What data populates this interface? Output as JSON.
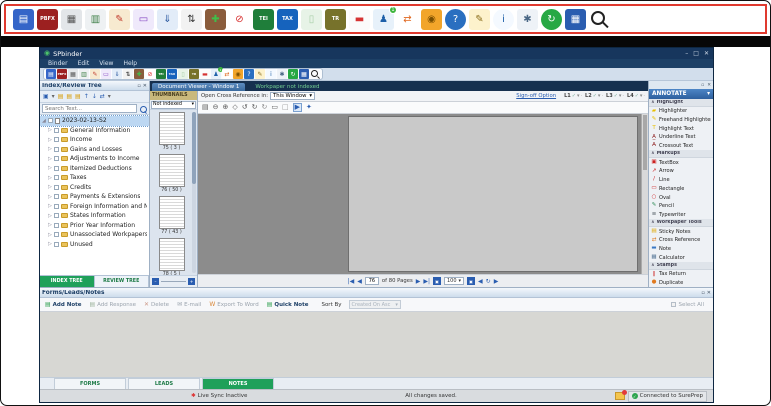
{
  "glyphs": {
    "check": "✓",
    "caret": "▾",
    "chevup": "∧",
    "close": "✕",
    "pin": "▫",
    "expander": "▷",
    "root_expander": "◢",
    "app": "◉",
    "sep": "·",
    "minimize": "–",
    "maximize": "□",
    "livesync": "✱"
  },
  "top_toolbar": {
    "icons": [
      {
        "name": "save-icon",
        "g": "▤",
        "fg": "#ffffff",
        "bg": "#3565c8"
      },
      {
        "name": "pbfx-export-icon",
        "g": "PBFX",
        "fg": "#ffffff",
        "bg": "#9c2020",
        "cls": "txt"
      },
      {
        "name": "print-icon",
        "g": "▦",
        "fg": "#555555",
        "bg": "#e3e6e9"
      },
      {
        "name": "print-preview-icon",
        "g": "▥",
        "fg": "#3a7d44",
        "bg": "#eef1f3"
      },
      {
        "name": "review-sheet-icon",
        "g": "✎",
        "fg": "#c0392b",
        "bg": "#f7ead0"
      },
      {
        "name": "send-to-screen-icon",
        "g": "▭",
        "fg": "#8040c0",
        "bg": "#efe9fb"
      },
      {
        "name": "network-transfer-icon",
        "g": "⇓",
        "fg": "#2c5aa0",
        "bg": "#e2ecf8"
      },
      {
        "name": "reorder-pages-icon",
        "g": "⇅",
        "fg": "#333333",
        "bg": "#f2f2f2"
      },
      {
        "name": "add-stamp-icon",
        "g": "✚",
        "fg": "#3fc04a",
        "bg": "#8a5c3c"
      },
      {
        "name": "restricted-icon",
        "g": "⊘",
        "fg": "#d62828",
        "bg": "#ffffff"
      },
      {
        "name": "tei-icon",
        "g": "TEI",
        "fg": "#ffffff",
        "bg": "#1f7e3a",
        "cls": "txt"
      },
      {
        "name": "tax-icon",
        "g": "TAX",
        "fg": "#ffffff",
        "bg": "#1663bd",
        "cls": "txt"
      },
      {
        "name": "binder-faded-icon",
        "g": "▯",
        "fg": "#a8cfa8",
        "bg": "#e7f3e7"
      },
      {
        "name": "tr-icon",
        "g": "TR",
        "fg": "#ffffff",
        "bg": "#77722b",
        "cls": "txt"
      },
      {
        "name": "sticky-note-icon",
        "g": "▬",
        "fg": "#d63333",
        "bg": "#fbfbfb"
      },
      {
        "name": "user-notifications-icon",
        "g": "♟",
        "fg": "#1d5fa8",
        "bg": "#e7f1fa",
        "badge": "1"
      },
      {
        "name": "transfer-arrows-icon",
        "g": "⇄",
        "fg": "#e06820",
        "bg": "#ffffff"
      },
      {
        "name": "lock-icon",
        "g": "◉",
        "fg": "#7a4f01",
        "bg": "#f2a52a"
      },
      {
        "name": "help-icon",
        "g": "?",
        "fg": "#ffffff",
        "bg": "#2a6fc0",
        "cls": "round"
      },
      {
        "name": "signer-icon",
        "g": "✎",
        "fg": "#8a6d1a",
        "bg": "#fdf2cc"
      },
      {
        "name": "info-icon",
        "g": "i",
        "fg": "#1d5fa8",
        "bg": "#f4f9ff",
        "cls": "round"
      },
      {
        "name": "user-settings-icon",
        "g": "✱",
        "fg": "#4a6785",
        "bg": "#eef2f7"
      },
      {
        "name": "sync-icon",
        "g": "↻",
        "fg": "#ffffff",
        "bg": "#27a844",
        "cls": "round"
      },
      {
        "name": "workspace-grid-icon",
        "g": "▦",
        "fg": "#ffffff",
        "bg": "#2a5db0"
      },
      {
        "name": "search-icon",
        "g": "",
        "fg": "#222222",
        "bg": "transparent",
        "cls": "searchy"
      }
    ]
  },
  "window": {
    "title": "SPbinder",
    "menus": [
      "Binder",
      "Edit",
      "View",
      "Help"
    ],
    "controls": [
      {
        "name": "minimize-button",
        "g": "–"
      },
      {
        "name": "maximize-button",
        "g": "□"
      },
      {
        "name": "close-button",
        "g": "✕"
      }
    ]
  },
  "tree_panel": {
    "header": "Index/Review Tree",
    "search_placeholder": "Search Text...",
    "toolbar": [
      {
        "name": "new-folder-icon",
        "g": "▣",
        "c": "#2a5db0"
      },
      {
        "name": "folder-menu-icon",
        "g": "▾",
        "c": "#666666"
      },
      {
        "name": "expand-all-icon",
        "g": "▤",
        "c": "#d79b00"
      },
      {
        "name": "collapse-all-icon",
        "g": "▤",
        "c": "#d79b00"
      },
      {
        "name": "folder-icon",
        "g": "▤",
        "c": "#d79b00"
      },
      {
        "name": "move-up-icon",
        "g": "↑",
        "c": "#2a5db0"
      },
      {
        "name": "move-down-icon",
        "g": "↓",
        "c": "#2a5db0"
      },
      {
        "name": "link-icon",
        "g": "⇄",
        "c": "#2a5db0"
      },
      {
        "name": "more-icon",
        "g": "▾",
        "c": "#666666"
      }
    ],
    "root": "2023-02-13-S2",
    "items": [
      "General Information",
      "Income",
      "Gains and Losses",
      "Adjustments to Income",
      "Itemized Deductions",
      "Taxes",
      "Credits",
      "Payments & Extensions",
      "Foreign Information and Nonresident",
      "States Information",
      "Prior Year Information",
      "Unassociated Workpapers",
      "Unused"
    ],
    "tabs": [
      {
        "label": "INDEX TREE",
        "cls": "active",
        "name": "tab-index-tree"
      },
      {
        "label": "REVIEW TREE",
        "name": "tab-review-tree"
      }
    ]
  },
  "thumbnails": {
    "header": "THUMBNAILS",
    "filter": "Not indexed",
    "pages": [
      "75 ( 3 )",
      "76 ( 50 )",
      "77 ( 43 )",
      "78 ( 5 )"
    ]
  },
  "viewer": {
    "tab": "Document Viewer - Window 1",
    "tab2": "Workpaper not indexed",
    "crossref_label": "Open Cross Reference in:",
    "crossref_value": "This Window",
    "signoff_link": "Sign-off Option",
    "signoff_levels": [
      "L1",
      "L2",
      "L3",
      "L4"
    ],
    "toolbar": [
      {
        "name": "print-page-icon",
        "g": "▤",
        "c": "#555555"
      },
      {
        "name": "zoom-out-icon",
        "g": "⊖",
        "c": "#555555"
      },
      {
        "name": "zoom-in-icon",
        "g": "⊕",
        "c": "#555555"
      },
      {
        "name": "pan-icon",
        "g": "◇",
        "c": "#555555"
      },
      {
        "name": "rotate-left-icon",
        "g": "↺",
        "c": "#555555"
      },
      {
        "name": "rotate-right-icon",
        "g": "↻",
        "c": "#555555"
      },
      {
        "name": "refresh-icon",
        "g": "↻",
        "c": "#888888"
      },
      {
        "name": "fit-page-icon",
        "g": "▭",
        "c": "#555555"
      },
      {
        "name": "fit-width-icon",
        "g": "□",
        "c": "#999999"
      },
      {
        "name": "play-icon",
        "g": "▶",
        "c": "#2a5db0",
        "cls": "boxed"
      },
      {
        "name": "viewer-settings-icon",
        "g": "✦",
        "c": "#2a5db0"
      }
    ],
    "nav": {
      "first": "|◀",
      "prev": "◀",
      "page": "76",
      "of": "of 80 Pages",
      "next": "▶",
      "last": "▶|",
      "box1": "▣",
      "zoom": "100",
      "box2": "▣",
      "back": "◀",
      "refresh": "↻",
      "fwd": "▶"
    }
  },
  "annotate": {
    "header": "ANNOTATE",
    "rows": [
      {
        "t": "h",
        "label": "HighLight",
        "name": "section-highlight"
      },
      {
        "t": "i",
        "label": "Highlighter",
        "g": "▰",
        "c": "#e8bf00",
        "name": "highlighter-icon"
      },
      {
        "t": "i",
        "label": "Freehand Highlighter",
        "g": "✎",
        "c": "#e8bf00",
        "name": "freehand-highlighter-icon"
      },
      {
        "t": "i",
        "label": "Highlight Text",
        "g": "T",
        "c": "#e8bf00",
        "name": "highlight-text-icon"
      },
      {
        "t": "i",
        "label": "Underline Text",
        "g": "A̲",
        "c": "#8b1a1a",
        "name": "underline-text-icon"
      },
      {
        "t": "i",
        "label": "Crossout Text",
        "g": "A̶",
        "c": "#8b1a1a",
        "name": "crossout-text-icon"
      },
      {
        "t": "h",
        "label": "Markups",
        "name": "section-markups"
      },
      {
        "t": "i",
        "label": "TextBox",
        "g": "▣",
        "c": "#cc2020",
        "name": "textbox-icon"
      },
      {
        "t": "i",
        "label": "Arrow",
        "g": "↗",
        "c": "#cc2020",
        "name": "arrow-icon"
      },
      {
        "t": "i",
        "label": "Line",
        "g": "/",
        "c": "#cc2020",
        "name": "line-icon"
      },
      {
        "t": "i",
        "label": "Rectangle",
        "g": "▭",
        "c": "#cc2020",
        "name": "rectangle-icon"
      },
      {
        "t": "i",
        "label": "Oval",
        "g": "○",
        "c": "#cc2020",
        "name": "oval-icon"
      },
      {
        "t": "i",
        "label": "Pencil",
        "g": "✎",
        "c": "#2e8b57",
        "name": "pencil-icon"
      },
      {
        "t": "i",
        "label": "Typewriter",
        "g": "≡",
        "c": "#556066",
        "name": "typewriter-icon"
      },
      {
        "t": "h",
        "label": "Workpaper Tools",
        "name": "section-workpaper-tools"
      },
      {
        "t": "i",
        "label": "Sticky Notes",
        "g": "▤",
        "c": "#e0a800",
        "name": "sticky-notes-icon"
      },
      {
        "t": "i",
        "label": "Cross Reference",
        "g": "⇄",
        "c": "#e07a20",
        "name": "cross-reference-icon"
      },
      {
        "t": "i",
        "label": "Note",
        "g": "▬",
        "c": "#3b78c4",
        "name": "note-icon"
      },
      {
        "t": "i",
        "label": "Calculator",
        "g": "▦",
        "c": "#5a7a9a",
        "name": "calculator-icon"
      },
      {
        "t": "h",
        "label": "Stamps",
        "name": "section-stamps"
      },
      {
        "t": "i",
        "label": "Tax Return",
        "g": "‖",
        "c": "#cc2020",
        "name": "tax-return-stamp-icon"
      },
      {
        "t": "i",
        "label": "Duplicate",
        "g": "●",
        "c": "#e07a20",
        "name": "duplicate-stamp-icon"
      }
    ]
  },
  "notes": {
    "header": "Forms/Leads/Notes",
    "buttons": [
      {
        "label": "Add Note",
        "g": "▤",
        "c": "#2e9e4f",
        "name": "add-note-button"
      },
      {
        "label": "Add Response",
        "g": "▤",
        "c": "#9db39d",
        "cls": "disabled",
        "name": "add-response-button"
      },
      {
        "label": "Delete",
        "g": "✕",
        "c": "#cc9988",
        "cls": "disabled",
        "name": "delete-note-button"
      },
      {
        "label": "E-mail",
        "g": "✉",
        "c": "#9aa3ad",
        "cls": "disabled",
        "name": "email-button"
      },
      {
        "label": "Export To Word",
        "g": "W",
        "c": "#d9893b",
        "cls": "disabled",
        "name": "export-to-word-button"
      },
      {
        "label": "Quick Note",
        "g": "▤",
        "c": "#2e9e4f",
        "name": "quick-note-button"
      }
    ],
    "sort_label": "Sort By",
    "sort_value": "Created On Asc",
    "select_all": "Select All",
    "tabs": [
      {
        "label": "FORMS",
        "name": "tab-forms"
      },
      {
        "label": "LEADS",
        "name": "tab-leads"
      },
      {
        "label": "NOTES",
        "cls": "active",
        "name": "tab-notes"
      }
    ],
    "status": {
      "live": "Live Sync Inactive",
      "center": "All changes saved.",
      "connected": "Connected to SurePrep"
    }
  }
}
